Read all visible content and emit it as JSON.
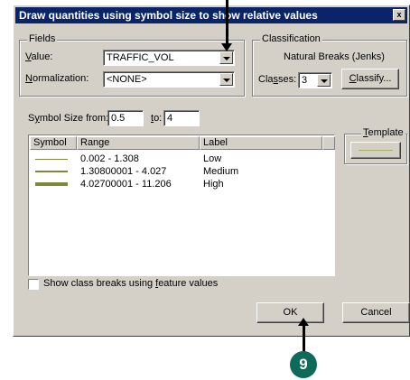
{
  "window": {
    "title": "Draw quantities using symbol size to show relative values",
    "close_glyph": "x"
  },
  "fields_group": {
    "legend": "Fields",
    "value_label_u": "V",
    "value_label_rest": "alue:",
    "value": "TRAFFIC_VOL",
    "normalization_label_u": "N",
    "normalization_label_rest": "ormalization:",
    "normalization": "<NONE>"
  },
  "classification_group": {
    "legend": "Classification",
    "method": "Natural Breaks (Jenks)",
    "classes_label_pre": "Cla",
    "classes_label_u": "s",
    "classes_label_post": "ses:",
    "classes_value": "3",
    "classify_button_u": "C",
    "classify_button_rest": "lassify..."
  },
  "symbol_size": {
    "from_label_pre": "S",
    "from_label_u": "y",
    "from_label_post": "mbol Size from:",
    "from_value": "0.5",
    "to_label_u": "t",
    "to_label_rest": "o:",
    "to_value": "4"
  },
  "template": {
    "label_u": "T",
    "label_rest": "emplate"
  },
  "table": {
    "headers": {
      "symbol": "Symbol",
      "range": "Range",
      "label": "Label"
    },
    "rows": [
      {
        "range": "0.002 - 1.308",
        "label": "Low"
      },
      {
        "range": "1.30800001 - 4.027",
        "label": "Medium"
      },
      {
        "range": "4.02700001 - 11.206",
        "label": "High"
      }
    ]
  },
  "show_breaks": {
    "label_pre": "Show class breaks using ",
    "label_u": "f",
    "label_post": "eature values",
    "checked": false
  },
  "buttons": {
    "ok": "OK",
    "cancel": "Cancel"
  },
  "callout": {
    "step": "9"
  },
  "colors": {
    "titlebar": "#0a246a",
    "symbol_line": "#7a8a38",
    "callout_badge": "#0f6b59",
    "dialog_face": "#d4d0c8"
  }
}
